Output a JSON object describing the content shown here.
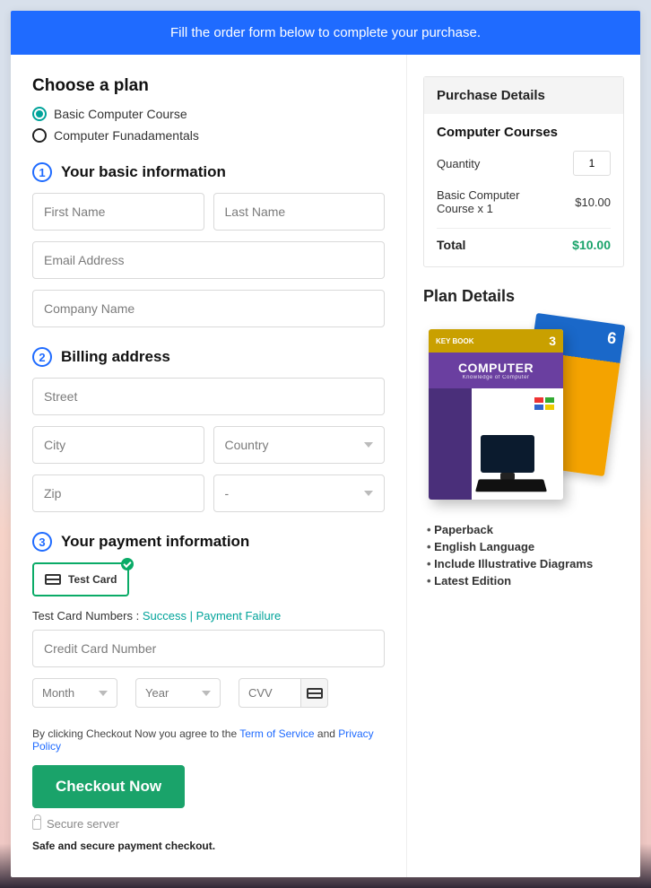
{
  "banner": "Fill the order form below to complete your purchase.",
  "plan": {
    "title": "Choose a plan",
    "options": [
      "Basic Computer Course",
      "Computer Funadamentals"
    ]
  },
  "step1": {
    "num": "1",
    "title": "Your basic information",
    "first_ph": "First Name",
    "last_ph": "Last Name",
    "email_ph": "Email Address",
    "company_ph": "Company Name"
  },
  "step2": {
    "num": "2",
    "title": "Billing address",
    "street_ph": "Street",
    "city_ph": "City",
    "country_ph": "Country",
    "zip_ph": "Zip",
    "state_ph": "-"
  },
  "step3": {
    "num": "3",
    "title": "Your payment information",
    "chip": "Test  Card",
    "hint_prefix": "Test Card Numbers : ",
    "hint_success": "Success",
    "hint_sep": " | ",
    "hint_fail": "Payment Failure",
    "cc_ph": "Credit Card Number",
    "month_ph": "Month",
    "year_ph": "Year",
    "cvv_ph": "CVV"
  },
  "agree": {
    "pre": "By clicking Checkout Now you agree to the ",
    "tos": "Term of Service",
    "and": " and ",
    "pp": "Privacy Policy"
  },
  "checkout": "Checkout Now",
  "secure": "Secure server",
  "safe": "Safe and secure payment checkout.",
  "purchase": {
    "head": "Purchase Details",
    "subhead": "Computer Courses",
    "qty_label": "Quantity",
    "qty_value": "1",
    "line_label": "Basic Computer Course x 1",
    "line_amount": "$10.00",
    "total_label": "Total",
    "total_amount": "$10.00"
  },
  "plan_details": {
    "title": "Plan Details",
    "book_front_small": "KEY BOOK",
    "book_front_num": "3",
    "book_front_title": "COMPUTER",
    "book_front_sub": "Knowledge of Computer",
    "book_back_num": "6",
    "features": [
      "Paperback",
      "English Language",
      "Include Illustrative Diagrams",
      "Latest Edition"
    ]
  }
}
